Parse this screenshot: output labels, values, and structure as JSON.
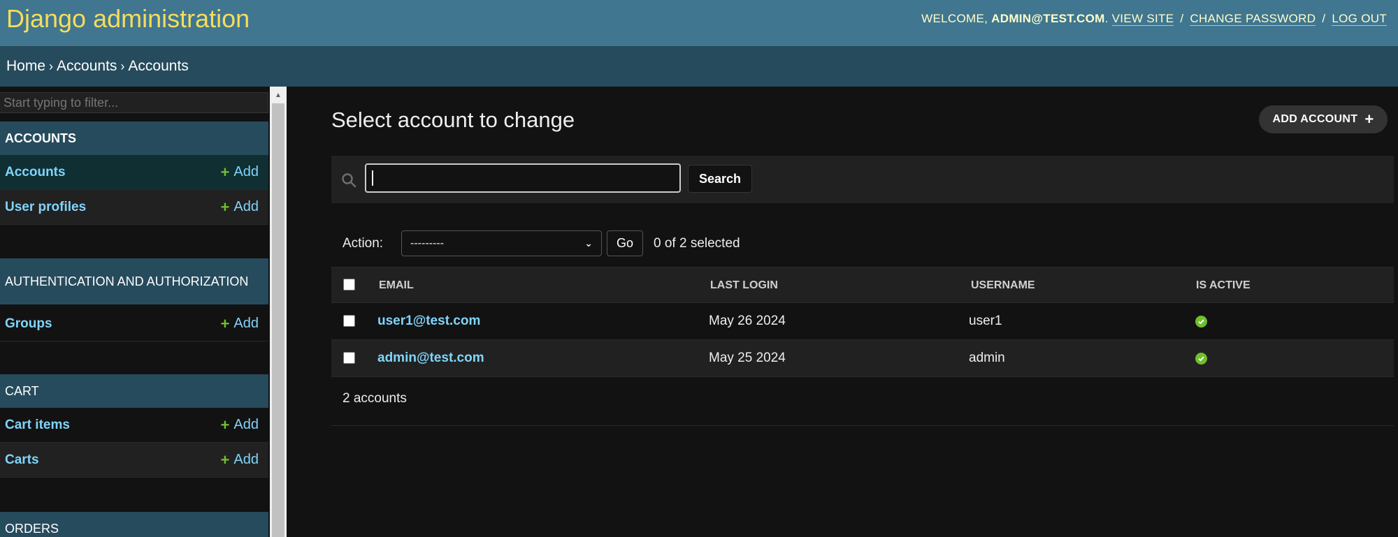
{
  "header": {
    "site_title": "Django administration",
    "welcome": "Welcome,",
    "user": "admin@test.com",
    "view_site": "View site",
    "change_password": "Change password",
    "log_out": "Log out",
    "separator": "/"
  },
  "breadcrumbs": {
    "home": "Home",
    "app": "Accounts",
    "current": "Accounts",
    "separator": "›"
  },
  "sidebar": {
    "filter_placeholder": "Start typing to filter...",
    "modules": [
      {
        "caption": "ACCOUNTS",
        "items": [
          {
            "label": "Accounts",
            "add": "Add"
          },
          {
            "label": "User profiles",
            "add": "Add"
          }
        ]
      },
      {
        "caption": "AUTHENTICATION AND AUTHORIZATION",
        "items": [
          {
            "label": "Groups",
            "add": "Add"
          }
        ]
      },
      {
        "caption": "CART",
        "items": [
          {
            "label": "Cart items",
            "add": "Add"
          },
          {
            "label": "Carts",
            "add": "Add"
          }
        ]
      },
      {
        "caption": "ORDERS",
        "items": []
      }
    ]
  },
  "main": {
    "title": "Select account to change",
    "add_button": "ADD ACCOUNT",
    "search": {
      "value": "",
      "button": "Search"
    },
    "actions": {
      "label": "Action:",
      "selected": "---------",
      "go": "Go",
      "counter": "0 of 2 selected"
    },
    "table": {
      "headers": [
        "EMAIL",
        "LAST LOGIN",
        "USERNAME",
        "IS ACTIVE"
      ],
      "rows": [
        {
          "email": "user1@test.com",
          "last_login": "May 26 2024",
          "username": "user1",
          "is_active": true
        },
        {
          "email": "admin@test.com",
          "last_login": "May 25 2024",
          "username": "admin",
          "is_active": true
        }
      ]
    },
    "paginator": "2 accounts"
  },
  "colors": {
    "header_bg": "#417690",
    "breadcrumb_bg": "#264b5d",
    "title_yellow": "#f5dd5d",
    "link": "#81d4fa",
    "success": "#70bf2b"
  }
}
